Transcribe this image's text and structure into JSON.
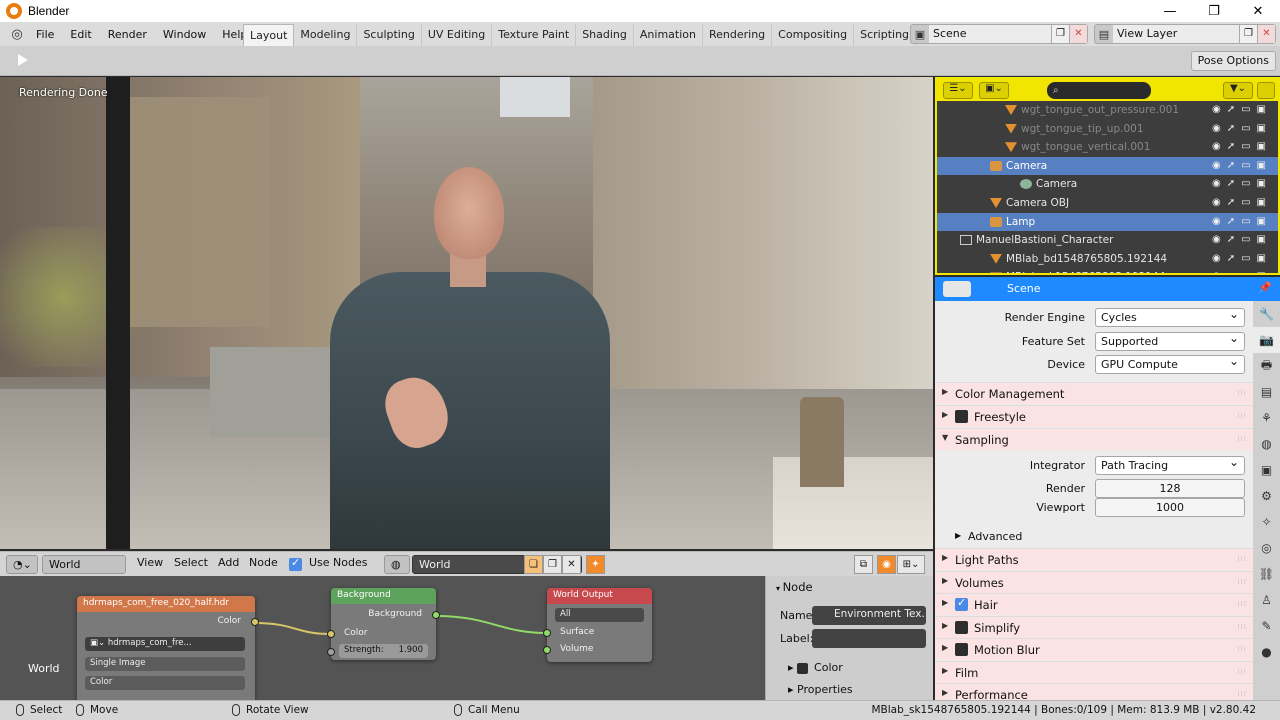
{
  "window": {
    "title": "Blender",
    "controls": [
      "—",
      "❐",
      "✕"
    ]
  },
  "topbar": {
    "menus": [
      "File",
      "Edit",
      "Render",
      "Window",
      "Help"
    ],
    "tabs": [
      "Layout",
      "Modeling",
      "Sculpting",
      "UV Editing",
      "Texture Paint",
      "Shading",
      "Animation",
      "Rendering",
      "Compositing",
      "Scripting"
    ],
    "active_tab": "Layout",
    "add_tab": "+",
    "scene": "Scene",
    "view_layer": "View Layer"
  },
  "toolheader": {
    "pose_options": "Pose Options"
  },
  "viewport": {
    "status": "Rendering Done"
  },
  "outliner": {
    "rows": [
      {
        "label": "wgt_tongue_out_pressure.001",
        "indent": 4,
        "icon": "bone",
        "dim": true,
        "sel": false
      },
      {
        "label": "wgt_tongue_tip_up.001",
        "indent": 4,
        "icon": "bone",
        "dim": true,
        "sel": false
      },
      {
        "label": "wgt_tongue_vertical.001",
        "indent": 4,
        "icon": "bone",
        "dim": true,
        "sel": false
      },
      {
        "label": "Camera",
        "indent": 3,
        "icon": "cam",
        "dim": false,
        "sel": true
      },
      {
        "label": "Camera",
        "indent": 5,
        "icon": "cdata",
        "dim": false,
        "sel": false
      },
      {
        "label": "Camera OBJ",
        "indent": 3,
        "icon": "bone",
        "dim": false,
        "sel": false
      },
      {
        "label": "Lamp",
        "indent": 3,
        "icon": "cam",
        "dim": false,
        "sel": true
      },
      {
        "label": "ManuelBastioni_Character",
        "indent": 1,
        "icon": "coll",
        "dim": false,
        "sel": false
      },
      {
        "label": "MBlab_bd1548765805.192144",
        "indent": 3,
        "icon": "bone",
        "dim": false,
        "sel": false
      },
      {
        "label": "MBlab_sk1548765805.192144",
        "indent": 3,
        "icon": "bone",
        "dim": false,
        "sel": false
      }
    ]
  },
  "properties": {
    "context": "Scene",
    "render_engine_label": "Render Engine",
    "render_engine": "Cycles",
    "feature_set_label": "Feature Set",
    "feature_set": "Supported",
    "device_label": "Device",
    "device": "GPU Compute",
    "panels": {
      "color_management": "Color Management",
      "freestyle": "Freestyle",
      "sampling": "Sampling",
      "advanced": "Advanced",
      "light_paths": "Light Paths",
      "volumes": "Volumes",
      "hair": "Hair",
      "simplify": "Simplify",
      "motion_blur": "Motion Blur",
      "film": "Film",
      "performance": "Performance"
    },
    "integrator_label": "Integrator",
    "integrator": "Path Tracing",
    "render_label": "Render",
    "render_samples": "128",
    "viewport_label": "Viewport",
    "viewport_samples": "1000"
  },
  "node_editor": {
    "world_type": "World",
    "menus": [
      "View",
      "Select",
      "Add",
      "Node"
    ],
    "use_nodes": "Use Nodes",
    "world_name": "World",
    "canvas_label": "World",
    "nodes": {
      "env": {
        "title": "hdrmaps_com_free_020_half.hdr",
        "out_color": "Color",
        "image": "hdrmaps_com_fre...",
        "source": "Single Image",
        "colorspace": "Color"
      },
      "bg": {
        "title": "Background",
        "out": "Background",
        "in_color": "Color",
        "strength": "Strength:",
        "strength_value": "1.900"
      },
      "out": {
        "title": "World Output",
        "target": "All",
        "surface": "Surface",
        "volume": "Volume"
      }
    },
    "side": {
      "header": "Node",
      "name_label": "Name:",
      "name_value": "Environment Tex...",
      "label_label": "Label:",
      "color": "Color",
      "properties": "Properties"
    }
  },
  "statusbar": {
    "select": "Select",
    "move": "Move",
    "rotate": "Rotate View",
    "call_menu": "Call Menu",
    "info": "MBlab_sk1548765805.192144 | Bones:0/109 | Mem: 813.9 MB | v2.80.42"
  }
}
